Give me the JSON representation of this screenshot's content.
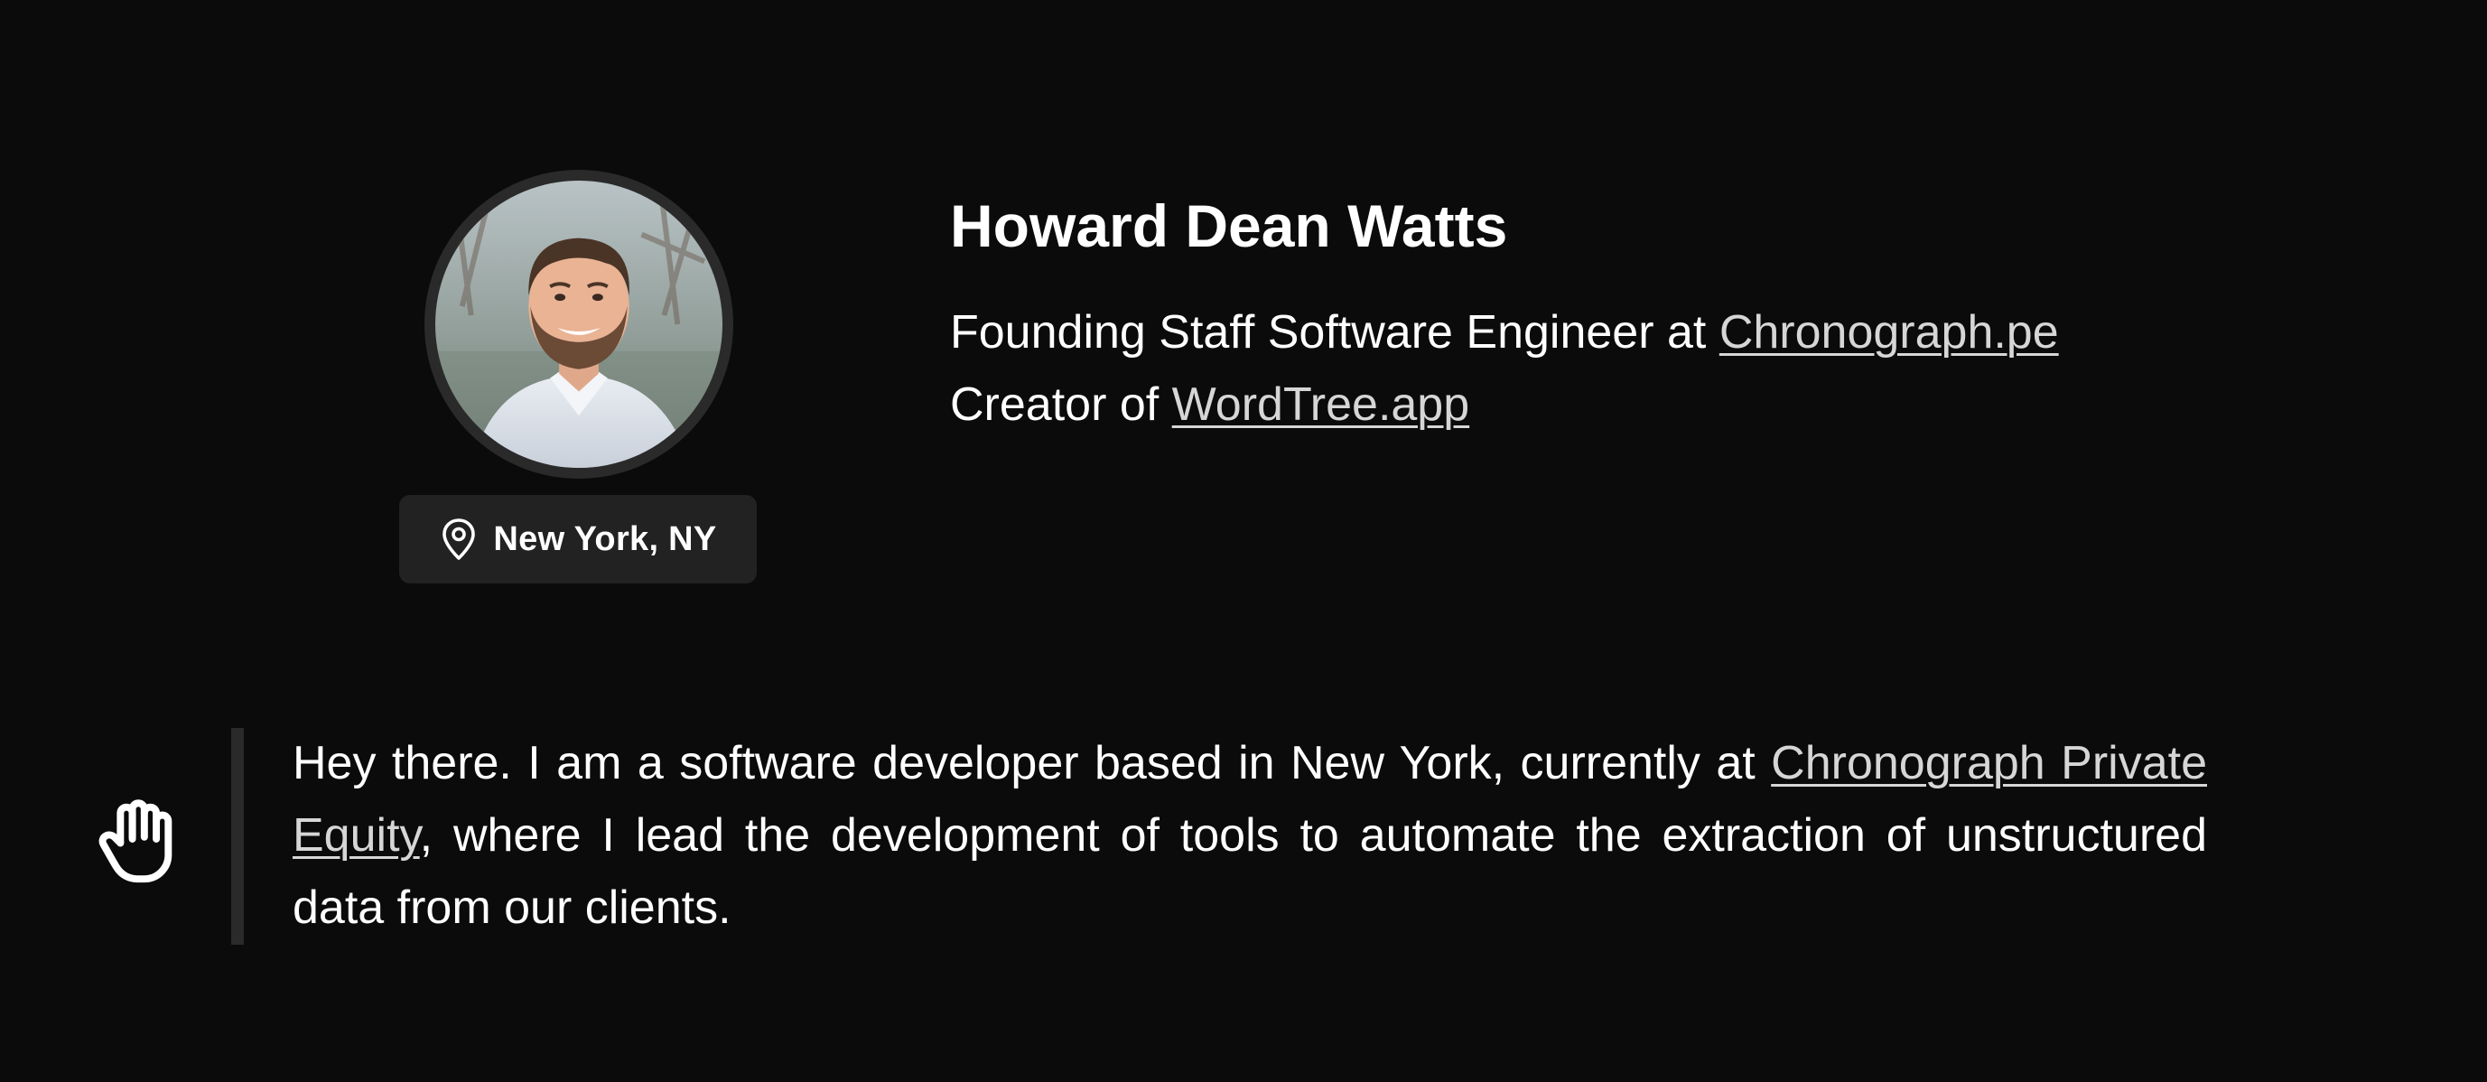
{
  "profile": {
    "name": "Howard Dean Watts",
    "avatar_icon": "portrait-photo",
    "location_icon": "map-pin-icon",
    "location": "New York, NY",
    "line1_prefix": "Founding Staff Software Engineer at ",
    "line1_link": "Chronograph.pe",
    "line2_prefix": "Creator of ",
    "line2_link": "WordTree.app"
  },
  "intro": {
    "icon": "waving-hand-icon",
    "text_before": "Hey there. I am a software developer based in New York, currently at ",
    "link": "Chronograph Private Equity",
    "text_after": ", where I lead the development of tools to automate the extraction of unstructured data from our clients."
  },
  "colors": {
    "background": "#0b0b0b",
    "text": "#ffffff",
    "link": "#d6d6d6",
    "badge_background": "#222222",
    "accent_bar": "#2a2a2a"
  }
}
